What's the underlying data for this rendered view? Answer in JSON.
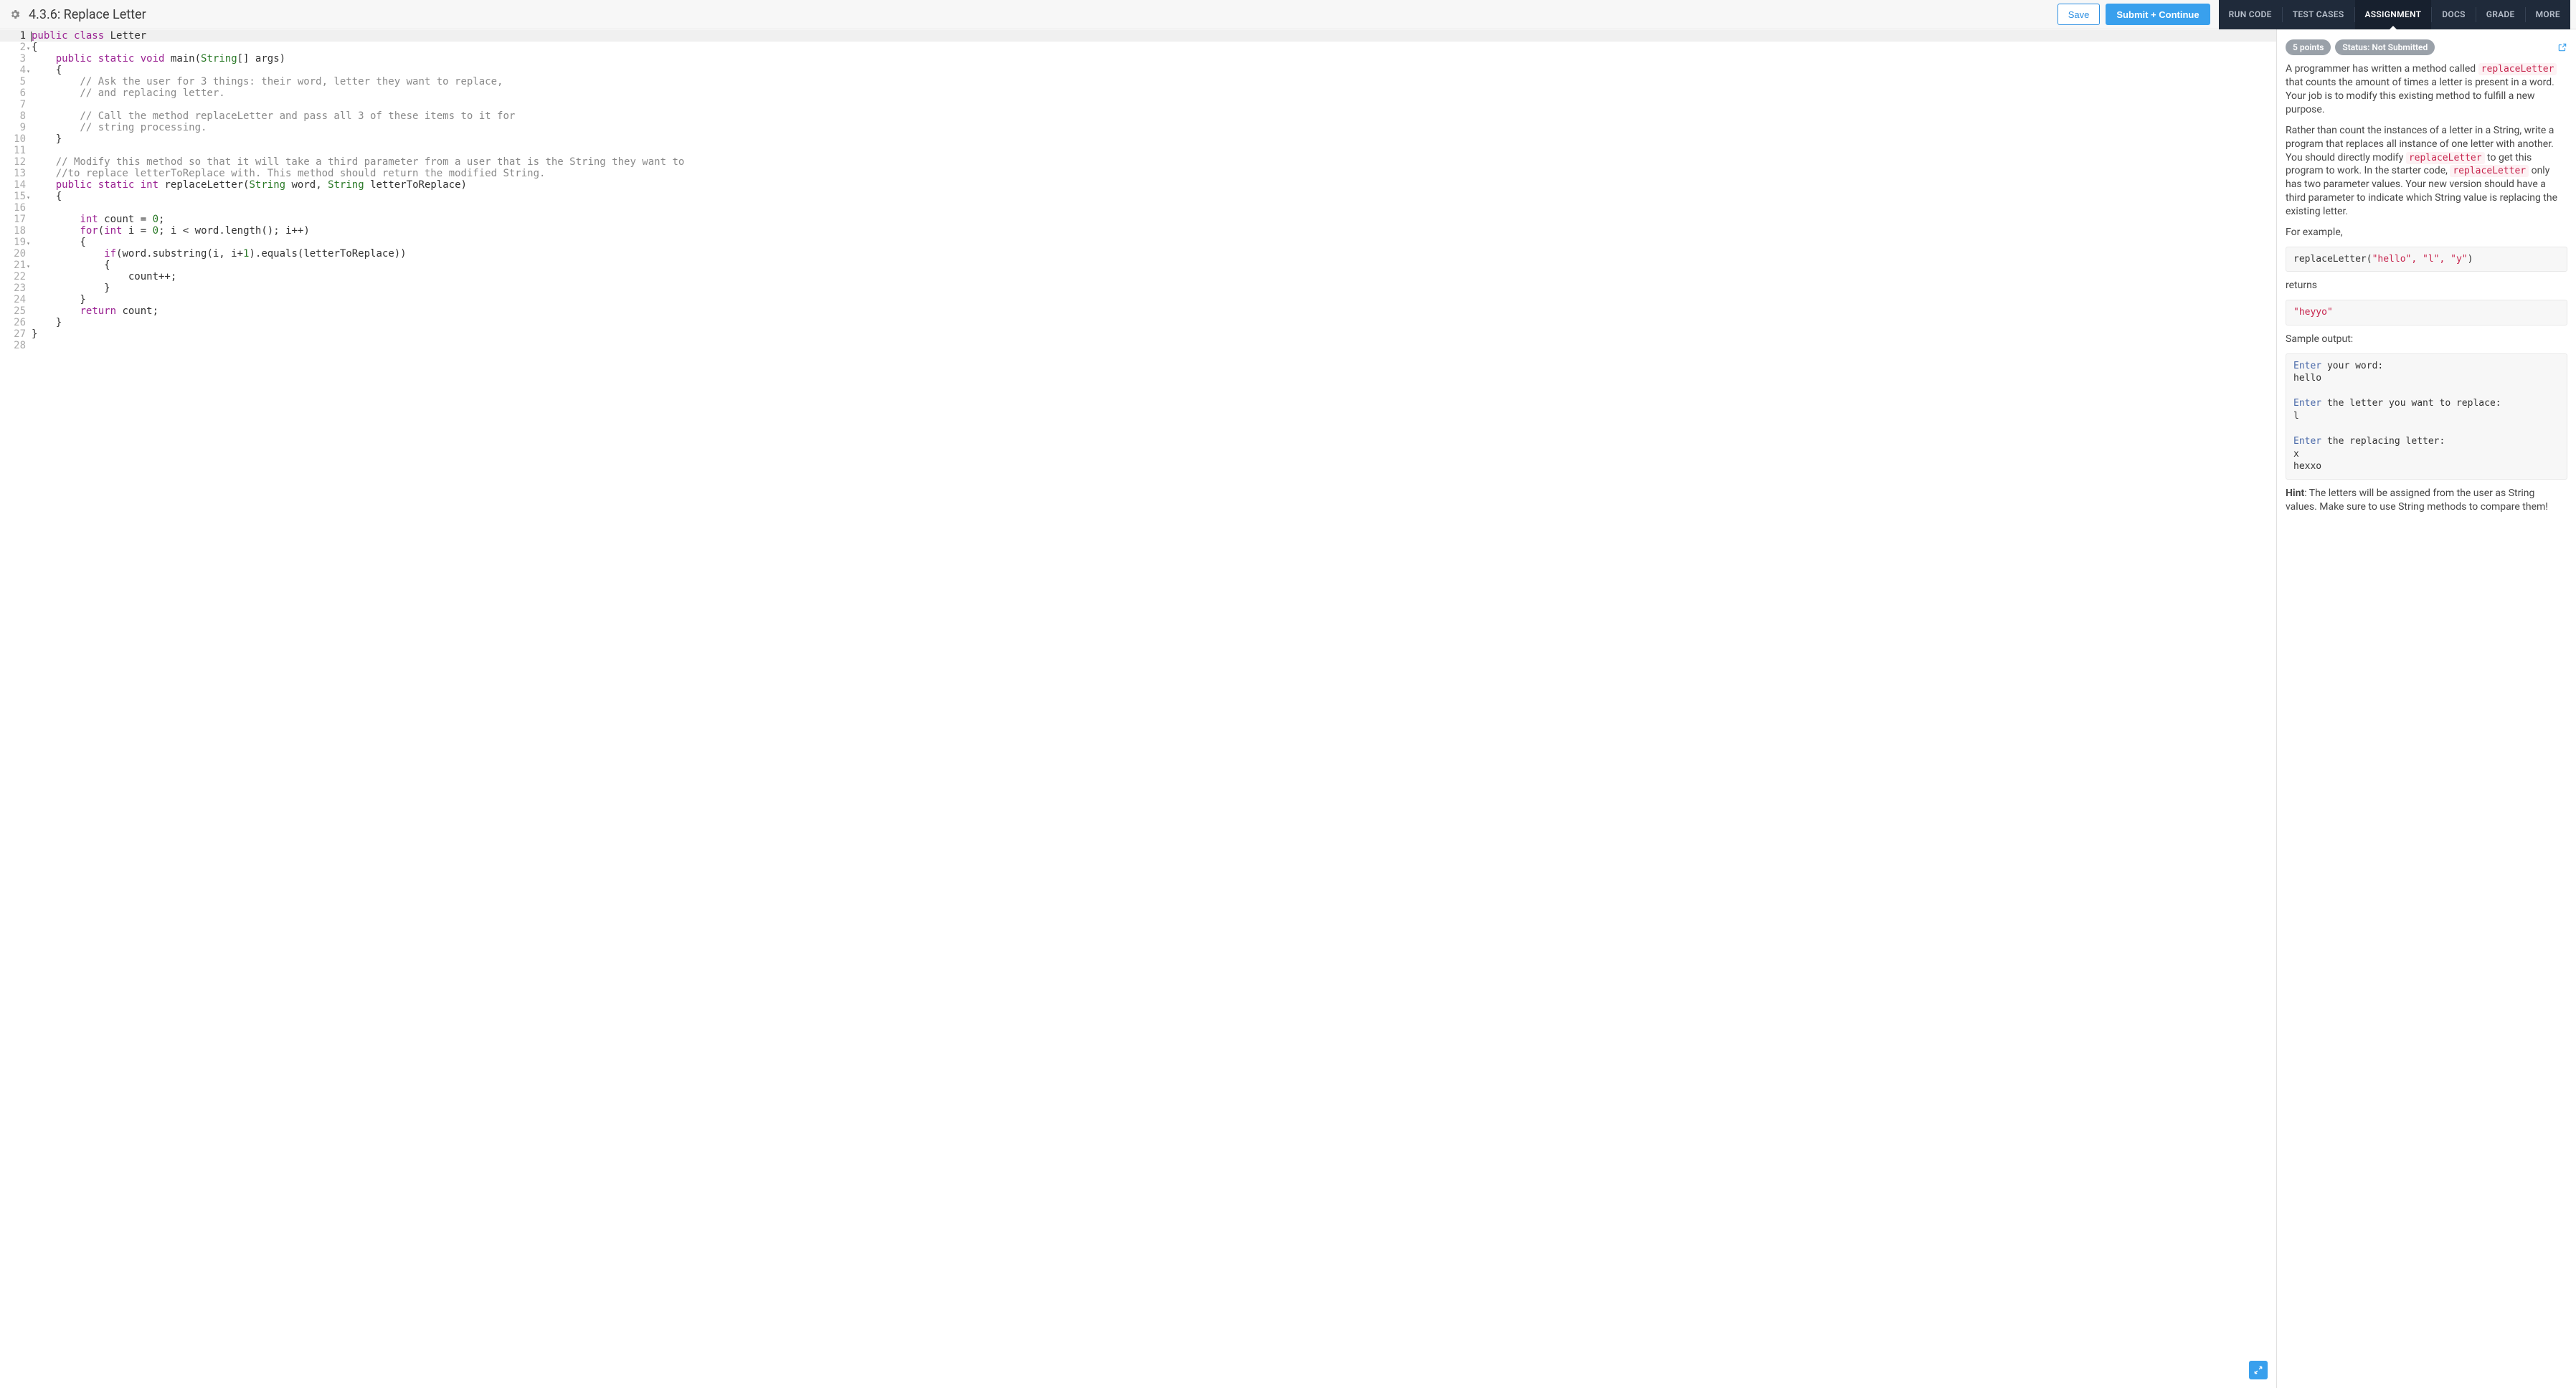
{
  "header": {
    "title": "4.3.6: Replace Letter",
    "save_label": "Save",
    "submit_label": "Submit + Continue"
  },
  "tabs": {
    "run_code": "RUN CODE",
    "test_cases": "TEST CASES",
    "assignment": "ASSIGNMENT",
    "docs": "DOCS",
    "grade": "GRADE",
    "more": "MORE",
    "active": "assignment"
  },
  "editor": {
    "line_count": 28,
    "fold_lines": [
      2,
      4,
      15,
      19,
      21
    ],
    "active_line": 1,
    "code": {
      "l1": {
        "kw1": "public",
        "kw2": "class",
        "name": "Letter"
      },
      "l2": "{",
      "l3": {
        "indent": "    ",
        "kw1": "public",
        "kw2": "static",
        "kw3": "void",
        "name": "main",
        "sig_open": "(",
        "type": "String",
        "arr": "[]",
        "arg": " args",
        "sig_close": ")"
      },
      "l4": "    {",
      "l5": "        // Ask the user for 3 things: their word, letter they want to replace,",
      "l6": "        // and replacing letter.",
      "l7": "",
      "l8": "        // Call the method replaceLetter and pass all 3 of these items to it for",
      "l9": "        // string processing.",
      "l10": "    }",
      "l11": "",
      "l12": "    // Modify this method so that it will take a third parameter from a user that is the String they want to",
      "l13": "    //to replace letterToReplace with. This method should return the modified String.",
      "l14": {
        "indent": "    ",
        "kw1": "public",
        "kw2": "static",
        "kw3": "int",
        "name": "replaceLetter",
        "sig_open": "(",
        "type1": "String",
        "arg1": " word, ",
        "type2": "String",
        "arg2": " letterToReplace",
        "sig_close": ")"
      },
      "l15": "    {",
      "l16": "",
      "l17": {
        "indent": "        ",
        "kw": "int",
        "rest": " count = ",
        "num": "0",
        "semi": ";"
      },
      "l18": {
        "indent": "        ",
        "kw1": "for",
        "open": "(",
        "kw2": "int",
        "mid": " i = ",
        "num1": "0",
        "cond": "; i < word.length(); i++",
        "close": ")"
      },
      "l19": "        {",
      "l20": {
        "indent": "            ",
        "kw": "if",
        "rest": "(word.substring(i, i+",
        "num": "1",
        "rest2": ").equals(letterToReplace))"
      },
      "l21": "            {",
      "l22": "                count++;",
      "l23": "            }",
      "l24": "        }",
      "l25": {
        "indent": "        ",
        "kw": "return",
        "rest": " count;"
      },
      "l26": "    }",
      "l27": "}",
      "l28": ""
    }
  },
  "assignment": {
    "points_badge": "5 points",
    "status_badge": "Status: Not Submitted",
    "p1_a": "A programmer has written a method called ",
    "p1_code": "replaceLetter",
    "p1_b": " that counts the amount of times a letter is present in a word. Your job is to modify this existing method to fulfill a new purpose.",
    "p2_a": "Rather than count the instances of a letter in a String, write a program that replaces all instance of one letter with another. You should directly modify ",
    "p2_code1": "replaceLetter",
    "p2_b": " to get this program to work. In the starter code, ",
    "p2_code2": "replaceLetter",
    "p2_c": " only has two parameter values. Your new version should have a third parameter to indicate which String value is replacing the existing letter.",
    "p3": "For example,",
    "example_call_fn": "replaceLetter(",
    "example_call_args": "\"hello\", \"l\", \"y\"",
    "example_call_close": ")",
    "returns_label": "returns",
    "example_return": "\"heyyo\"",
    "sample_label": "Sample output:",
    "sample": {
      "s1p": "Enter",
      "s1r": " your word:",
      "s1v": "hello",
      "s2p": "Enter",
      "s2r": " the letter you want to replace:",
      "s2v": "l",
      "s3p": "Enter",
      "s3r": " the replacing letter:",
      "s3v": "x",
      "s3out": "hexxo"
    },
    "hint_label": "Hint",
    "hint": ": The letters will be assigned from the user as String values. Make sure to use String methods to compare them!"
  }
}
